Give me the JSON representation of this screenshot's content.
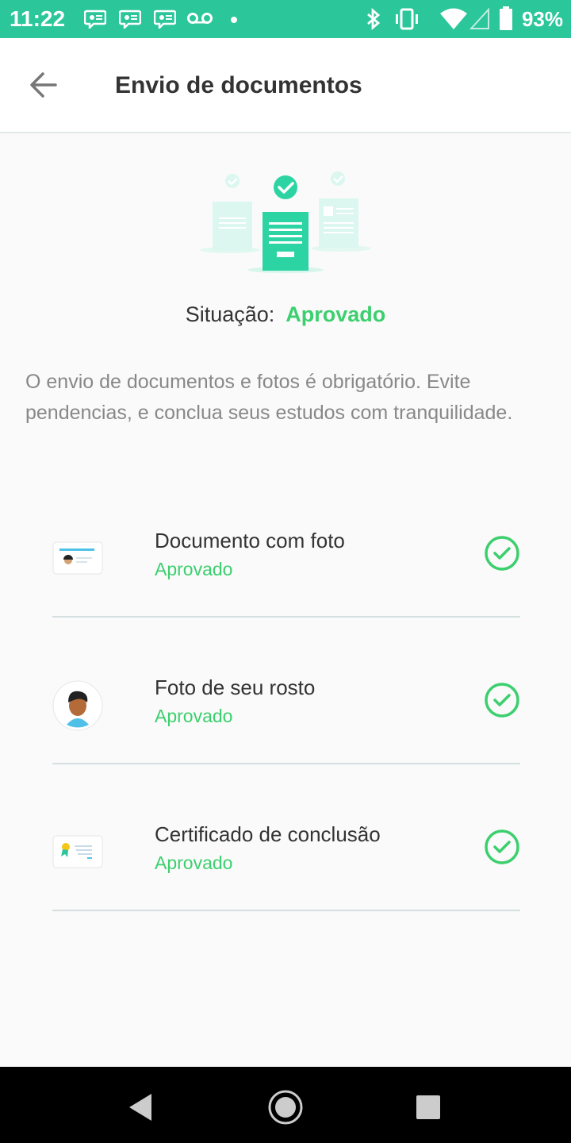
{
  "status_bar": {
    "time": "11:22",
    "notification_icons": [
      "message-icon",
      "message-icon",
      "message-icon",
      "voicemail-icon",
      "dot-icon"
    ],
    "battery": "93%"
  },
  "app_bar": {
    "title": "Envio de documentos",
    "back_icon": "arrow-back-icon"
  },
  "status": {
    "label": "Situação:",
    "value": "Aprovado"
  },
  "description": "O envio de documentos e fotos é obrigatório. Evite pendencias, e conclua seus estudos com tranquilidade.",
  "documents": [
    {
      "name": "Documento com foto",
      "status": "Aprovado",
      "icon": "id-card-icon"
    },
    {
      "name": "Foto de seu rosto",
      "status": "Aprovado",
      "icon": "face-photo-icon"
    },
    {
      "name": "Certificado de conclusão",
      "status": "Aprovado",
      "icon": "certificate-icon"
    }
  ],
  "colors": {
    "status_bar": "#2bc69a",
    "accent_green": "#3ccf6e",
    "illustration": "#2dd4a3"
  }
}
